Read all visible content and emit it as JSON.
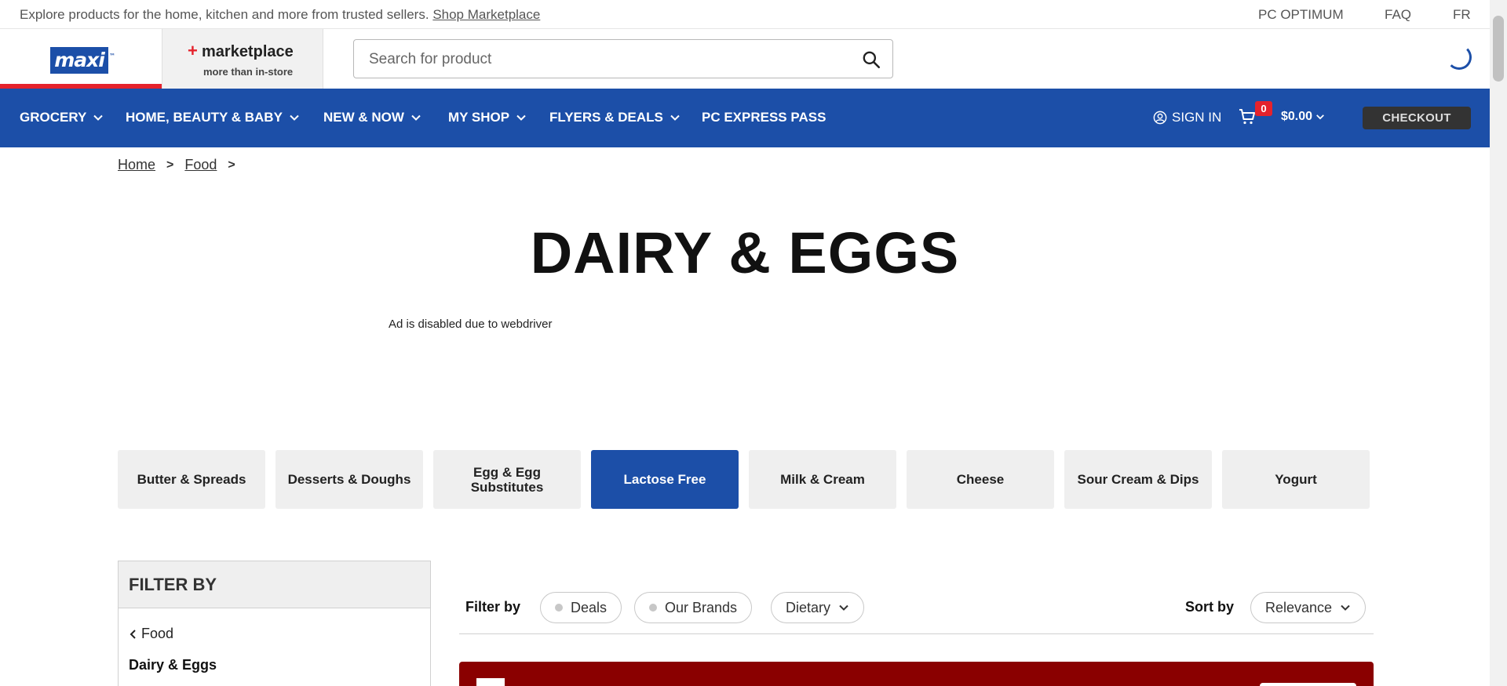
{
  "topbar": {
    "promo_text": "Explore products for the home, kitchen and more from trusted sellers.",
    "promo_link": "Shop Marketplace",
    "pc_optimum": "PC OPTIMUM",
    "faq": "FAQ",
    "lang": "FR"
  },
  "header": {
    "logo_text": "maxi",
    "logo_tm": "™",
    "marketplace_plus": "+",
    "marketplace_title": "marketplace",
    "marketplace_sub": "more than in-store",
    "search_placeholder": "Search for product"
  },
  "nav": {
    "items": [
      {
        "label": "GROCERY"
      },
      {
        "label": "HOME, BEAUTY & BABY"
      },
      {
        "label": "NEW & NOW"
      },
      {
        "label": "MY SHOP"
      },
      {
        "label": "FLYERS & DEALS"
      },
      {
        "label": "PC EXPRESS PASS"
      }
    ],
    "sign_in": "SIGN IN",
    "cart_count": "0",
    "cart_total": "$0.00",
    "checkout": "CHECKOUT"
  },
  "breadcrumb": {
    "home": "Home",
    "food": "Food",
    "separator": ">"
  },
  "page": {
    "title": "DAIRY & EGGS",
    "ad_note": "Ad is disabled due to webdriver"
  },
  "categories": [
    {
      "label": "Butter & Spreads",
      "active": false
    },
    {
      "label": "Desserts & Doughs",
      "active": false
    },
    {
      "label": "Egg & Egg Substitutes",
      "active": false
    },
    {
      "label": "Lactose Free",
      "active": true
    },
    {
      "label": "Milk & Cream",
      "active": false
    },
    {
      "label": "Cheese",
      "active": false
    },
    {
      "label": "Sour Cream & Dips",
      "active": false
    },
    {
      "label": "Yogurt",
      "active": false
    }
  ],
  "filter_panel": {
    "heading": "FILTER BY",
    "back_label": "Food",
    "current": "Dairy & Eggs"
  },
  "filters": {
    "label": "Filter by",
    "deals": "Deals",
    "our_brands": "Our Brands",
    "dietary": "Dietary",
    "sort_label": "Sort by",
    "sort_value": "Relevance"
  },
  "colors": {
    "brand_blue": "#1c4fa8",
    "brand_red": "#e5222c",
    "checkout_bg": "#333333",
    "banner_red": "#8a0000"
  }
}
